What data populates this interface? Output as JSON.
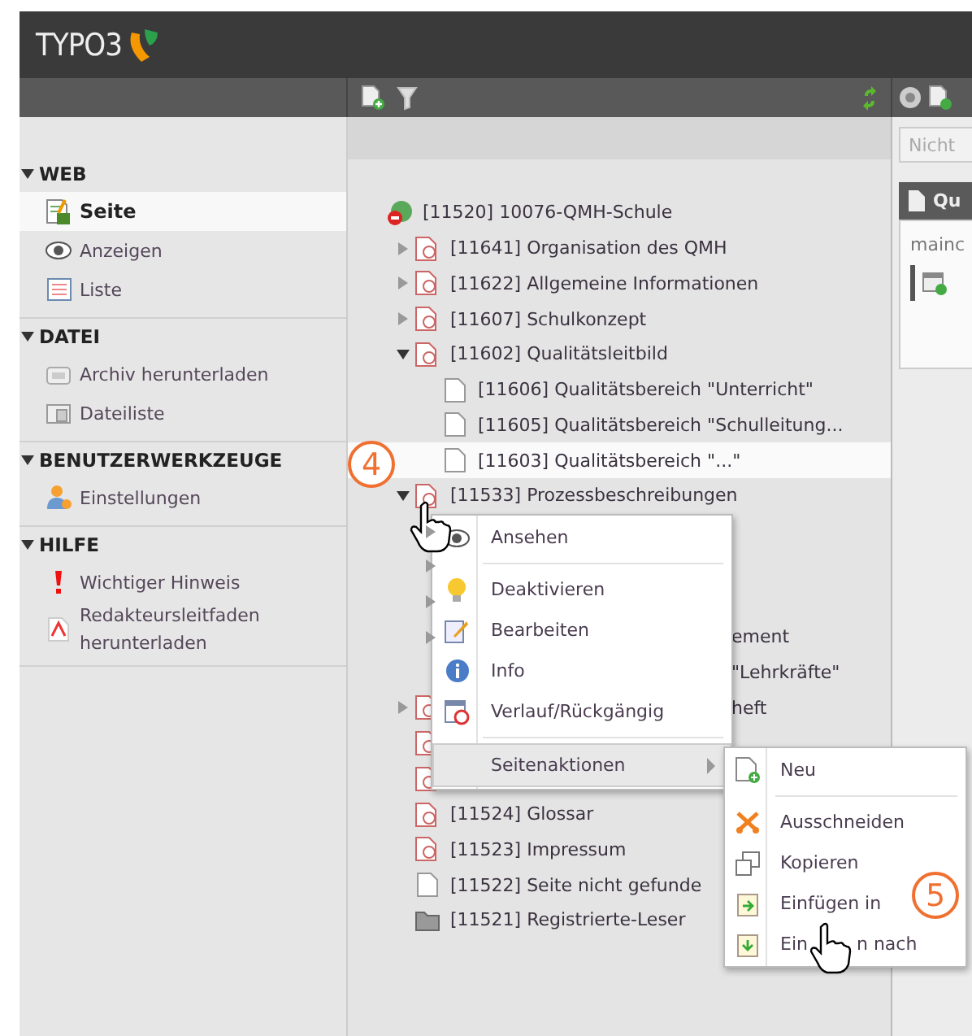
{
  "header": {
    "logo": "TYPO3"
  },
  "sidebar": {
    "sections": [
      {
        "title": "WEB",
        "expanded": true,
        "items": [
          {
            "label": "Seite",
            "kind": "page",
            "selected": true
          },
          {
            "label": "Anzeigen",
            "kind": "eye",
            "selected": false
          },
          {
            "label": "Liste",
            "kind": "list",
            "selected": false
          }
        ]
      },
      {
        "title": "DATEI",
        "expanded": true,
        "items": [
          {
            "label": "Archiv herunterladen",
            "kind": "archive",
            "selected": false
          },
          {
            "label": "Dateiliste",
            "kind": "files",
            "selected": false
          }
        ]
      },
      {
        "title": "BENUTZERWERKZEUGE",
        "expanded": true,
        "items": [
          {
            "label": "Einstellungen",
            "kind": "user",
            "selected": false
          }
        ]
      },
      {
        "title": "HILFE",
        "expanded": true,
        "items": [
          {
            "label": "Wichtiger Hinweis",
            "kind": "alert",
            "selected": false
          },
          {
            "label": "Redakteursleitfaden herunterladen",
            "kind": "pdf",
            "selected": false
          }
        ]
      }
    ]
  },
  "tree": {
    "root": {
      "label": "[11520] 10076-QMH-Schule",
      "kind": "root",
      "children": [
        {
          "label": "[11641] Organisation des QMH",
          "kind": "page",
          "expanded": false
        },
        {
          "label": "[11622] Allgemeine Informationen",
          "kind": "page",
          "expanded": false
        },
        {
          "label": "[11607] Schulkonzept",
          "kind": "page",
          "expanded": false
        },
        {
          "label": "[11602] Qualitätsleitbild",
          "kind": "page",
          "expanded": true,
          "children": [
            {
              "label": "[11606] Qualitätsbereich \"Unterricht\"",
              "kind": "plain"
            },
            {
              "label": "[11605] Qualitätsbereich \"Schulleitung...",
              "kind": "plain"
            },
            {
              "label": "[11603] Qualitätsbereich \"...\"",
              "kind": "plain",
              "hovered": true
            }
          ]
        },
        {
          "label": "[11533] Prozessbeschreibungen",
          "kind": "page",
          "expanded": true,
          "children": [
            {
              "kind": "hidden",
              "covered": true,
              "expanded": false
            },
            {
              "kind": "hidden",
              "covered": true,
              "expanded": false
            },
            {
              "kind": "hidden",
              "covered": true,
              "expanded": false
            },
            {
              "label": "ement",
              "kind": "hidden",
              "covered": true,
              "expanded": false
            },
            {
              "label": "\"Lehrkräfte\"",
              "kind": "hidden",
              "covered": true
            }
          ]
        },
        {
          "label": "heft",
          "kind": "page",
          "covered": true,
          "expanded": false
        },
        {
          "kind": "page",
          "covered": true
        },
        {
          "kind": "page",
          "covered": true
        },
        {
          "label": "[11524] Glossar",
          "kind": "page"
        },
        {
          "label": "[11523] Impressum",
          "kind": "page"
        },
        {
          "label": "[11522] Seite nicht gefunde",
          "kind": "plain"
        },
        {
          "label": "[11521] Registrierte-Leser",
          "kind": "folder"
        }
      ]
    }
  },
  "context_menu": {
    "items": [
      {
        "label": "Ansehen",
        "kind": "eye",
        "selected": false,
        "separator_after": true
      },
      {
        "label": "Deaktivieren",
        "kind": "bulb",
        "selected": false
      },
      {
        "label": "Bearbeiten",
        "kind": "edit",
        "selected": false
      },
      {
        "label": "Info",
        "kind": "info",
        "selected": false
      },
      {
        "label": "Verlauf/Rückgängig",
        "kind": "history",
        "selected": false,
        "separator_after": true
      },
      {
        "label": "Seitenaktionen",
        "kind": "submenu",
        "selected": true
      }
    ]
  },
  "submenu": {
    "items": [
      {
        "label": "Neu",
        "kind": "new",
        "selected": false,
        "separator_after": true
      },
      {
        "label": "Ausschneiden",
        "kind": "cut",
        "selected": false
      },
      {
        "label": "Kopieren",
        "kind": "copy",
        "selected": false
      },
      {
        "label": "Einfügen in",
        "kind": "paste-in",
        "selected": false
      },
      {
        "label": "Ein",
        "label_end": "n nach",
        "kind": "paste-after",
        "selected": false
      }
    ]
  },
  "right_panel": {
    "button": "Nicht",
    "panel_title": "Qu",
    "content_label": "mainc"
  },
  "annotations": [
    {
      "number": "4"
    },
    {
      "number": "5"
    }
  ]
}
